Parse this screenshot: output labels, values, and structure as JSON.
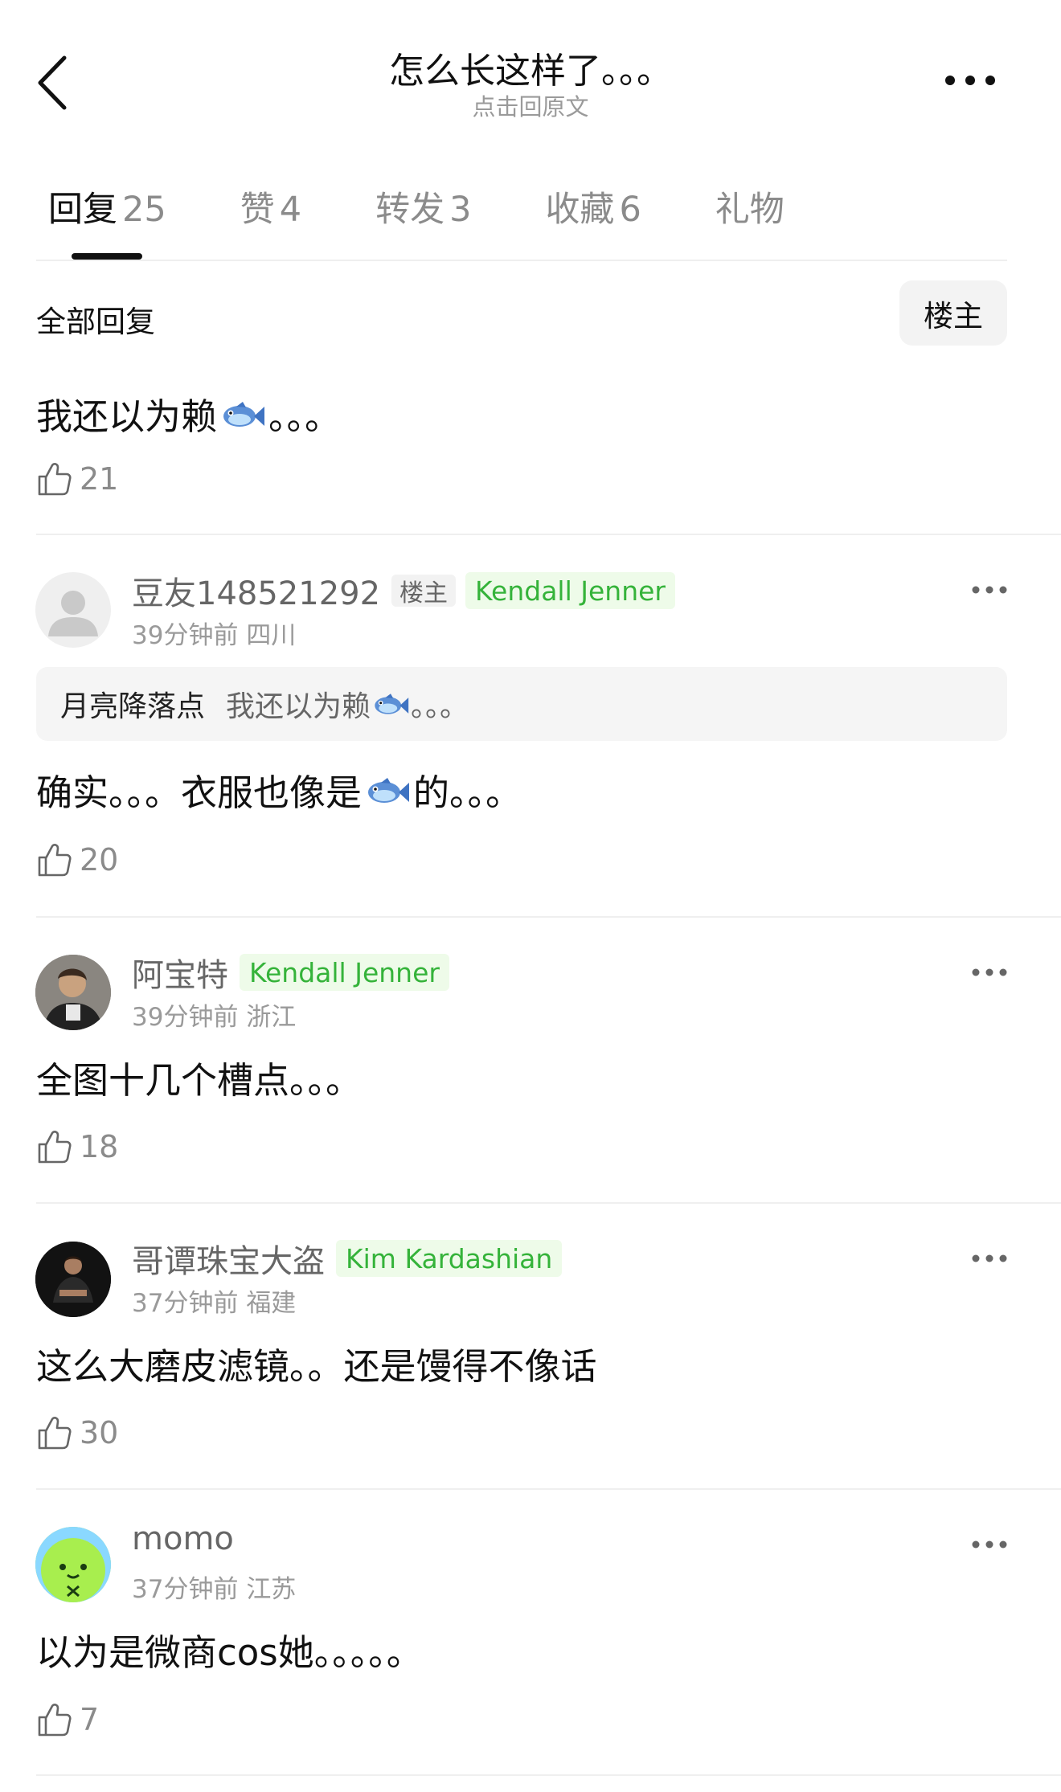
{
  "header": {
    "title": "怎么长这样了。。。",
    "subtitle": "点击回原文"
  },
  "tabs": [
    {
      "label": "回复",
      "count": "25",
      "active": true
    },
    {
      "label": "赞",
      "count": "4",
      "active": false
    },
    {
      "label": "转发",
      "count": "3",
      "active": false
    },
    {
      "label": "收藏",
      "count": "6",
      "active": false
    },
    {
      "label": "礼物",
      "count": "",
      "active": false
    }
  ],
  "filter": {
    "label": "全部回复",
    "op_only_button": "楼主"
  },
  "comments": [
    {
      "text_before": "我还以为赖",
      "emoji": "fish-emoji",
      "text_after": "。。。",
      "likes": "21"
    },
    {
      "user": "豆友148521292",
      "op_tag": "楼主",
      "badge": "Kendall Jenner",
      "time": "39分钟前",
      "location": "四川",
      "quote": {
        "author": "月亮降落点",
        "text_before": "我还以为赖",
        "text_after": "。。。"
      },
      "text_before": "确实。。。衣服也像是",
      "emoji": "fish-emoji",
      "text_after": "的。。。",
      "likes": "20"
    },
    {
      "user": "阿宝特",
      "badge": "Kendall Jenner",
      "time": "39分钟前",
      "location": "浙江",
      "text": "全图十几个槽点。。。",
      "likes": "18"
    },
    {
      "user": "哥谭珠宝大盗",
      "badge": "Kim Kardashian",
      "time": "37分钟前",
      "location": "福建",
      "text": "这么大磨皮滤镜。。还是馒得不像话",
      "likes": "30"
    },
    {
      "user": "momo",
      "time": "37分钟前",
      "location": "江苏",
      "text": "以为是微商cos她。。。。。",
      "likes": "7"
    }
  ],
  "colors": {
    "badge_green": "#35b33a",
    "badge_green_bg": "#eefbe9",
    "text_primary": "#111111",
    "text_secondary": "#8b8b8b"
  }
}
